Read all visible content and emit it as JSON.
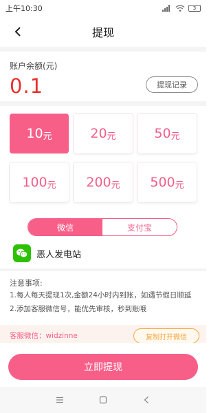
{
  "status_bar": {
    "time": "上午10:30",
    "battery": "3"
  },
  "nav": {
    "title": "提现"
  },
  "balance": {
    "label": "账户余额(元)",
    "value": "0.1",
    "history_button": "提现记录"
  },
  "amounts": [
    {
      "num": "10",
      "unit": "元",
      "selected": true
    },
    {
      "num": "20",
      "unit": "元",
      "selected": false
    },
    {
      "num": "50",
      "unit": "元",
      "selected": false
    },
    {
      "num": "100",
      "unit": "元",
      "selected": false
    },
    {
      "num": "200",
      "unit": "元",
      "selected": false
    },
    {
      "num": "500",
      "unit": "元",
      "selected": false
    }
  ],
  "payment_tabs": [
    {
      "label": "微信",
      "active": true
    },
    {
      "label": "支付宝",
      "active": false
    }
  ],
  "account": {
    "name": "恶人发电站",
    "icon": "wechat-icon"
  },
  "notice": {
    "title": "注意事项:",
    "lines": [
      "1.每人每天提现1次,金额24小时内到账，如遇节假日顺延",
      "2.添加客服微信号，能优先审核，秒到账哦"
    ]
  },
  "service": {
    "text": "客服微信：widzinne",
    "copy_button": "复制打开微信"
  },
  "submit_button": "立即提现",
  "colors": {
    "accent": "#f75f89",
    "balance": "#e8302c",
    "wechat": "#2dc100",
    "copy": "#f4a63c"
  }
}
